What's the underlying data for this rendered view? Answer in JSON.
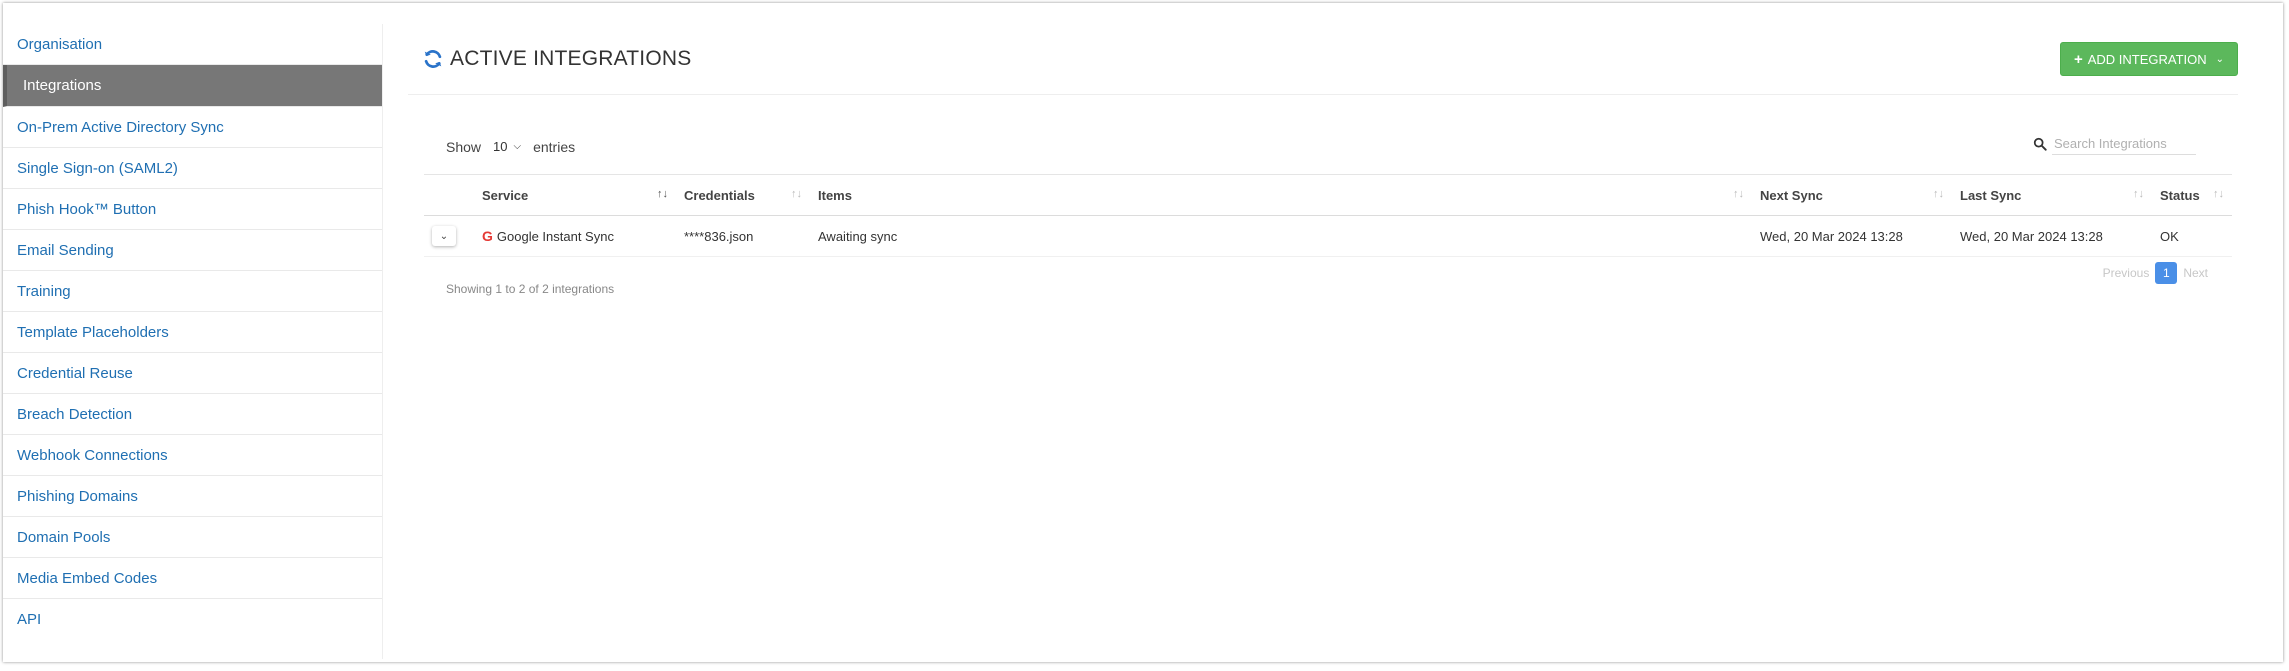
{
  "sidebar": {
    "items": [
      {
        "label": "Organisation"
      },
      {
        "label": "Integrations",
        "active": true
      },
      {
        "label": "On-Prem Active Directory Sync"
      },
      {
        "label": "Single Sign-on (SAML2)"
      },
      {
        "label": "Phish Hook™ Button"
      },
      {
        "label": "Email Sending"
      },
      {
        "label": "Training"
      },
      {
        "label": "Template Placeholders"
      },
      {
        "label": "Credential Reuse"
      },
      {
        "label": "Breach Detection"
      },
      {
        "label": "Webhook Connections"
      },
      {
        "label": "Phishing Domains"
      },
      {
        "label": "Domain Pools"
      },
      {
        "label": "Media Embed Codes"
      },
      {
        "label": "API"
      }
    ]
  },
  "header": {
    "title": "ACTIVE INTEGRATIONS",
    "add_label": "ADD INTEGRATION"
  },
  "controls": {
    "show_label": "Show",
    "entries_value": "10",
    "entries_label": "entries",
    "search_placeholder": "Search Integrations"
  },
  "table": {
    "columns": [
      "Service",
      "Credentials",
      "Items",
      "Next Sync",
      "Last Sync",
      "Status"
    ],
    "rows": [
      {
        "service": "Google Instant Sync",
        "service_icon": "G",
        "credentials": "****836.json",
        "items": "Awaiting sync",
        "next_sync": "Wed, 20 Mar 2024 13:28",
        "last_sync": "Wed, 20 Mar 2024 13:28",
        "status": "OK"
      }
    ]
  },
  "footer": {
    "info": "Showing 1 to 2 of 2 integrations",
    "previous": "Previous",
    "page": "1",
    "next": "Next"
  },
  "colors": {
    "accent": "#5cb85c",
    "link": "#1f6fb2",
    "active_sidebar": "#777777",
    "page_active": "#4a8fe7",
    "google_icon": "#e53935"
  }
}
